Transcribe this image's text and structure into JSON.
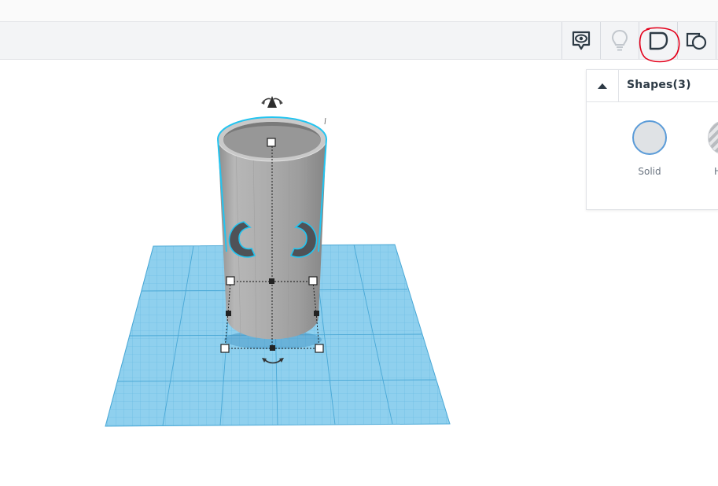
{
  "toolbar": {
    "buttons": [
      {
        "name": "view-icon"
      },
      {
        "name": "lightbulb-icon"
      },
      {
        "name": "shape-outline-icon"
      },
      {
        "name": "group-shapes-icon"
      }
    ],
    "highlight_color": "#e3001b"
  },
  "shapes_panel": {
    "title": "Shapes(3)",
    "options": [
      {
        "label": "Solid",
        "selected": true
      },
      {
        "label": "H",
        "selected": false
      }
    ]
  },
  "colors": {
    "grid": "#8fd0ee",
    "grid_line": "#5fb7e0",
    "selection": "#22c4f0",
    "shape_gray": "#a8a8a8"
  }
}
